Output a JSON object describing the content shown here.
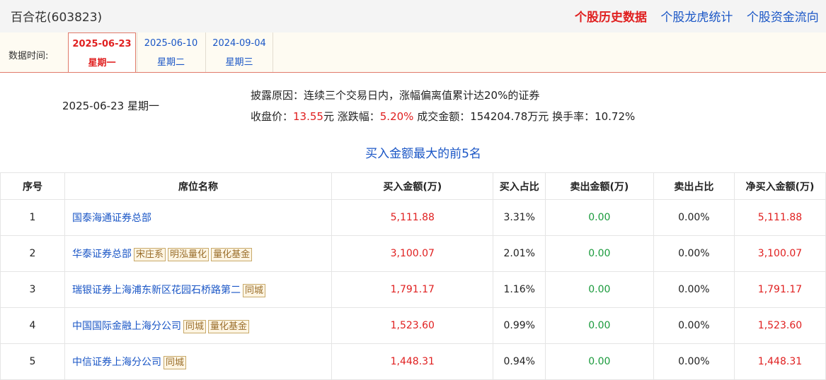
{
  "header": {
    "stock_title": "百合花(603823)",
    "links": [
      {
        "label": "个股历史数据",
        "active": true
      },
      {
        "label": "个股龙虎统计",
        "active": false
      },
      {
        "label": "个股资金流向",
        "active": false
      }
    ]
  },
  "date_bar": {
    "label": "数据时间:",
    "tabs": [
      {
        "date": "2025-06-23",
        "weekday": "星期一",
        "active": true
      },
      {
        "date": "2025-06-10",
        "weekday": "星期二",
        "active": false
      },
      {
        "date": "2024-09-04",
        "weekday": "星期三",
        "active": false
      }
    ]
  },
  "summary": {
    "date": "2025-06-23 星期一",
    "reason": "披露原因：连续三个交易日内，涨幅偏离值累计达20%的证券",
    "close_label": "收盘价：",
    "close_value": "13.55",
    "close_unit": "元 ",
    "change_label": "涨跌幅：",
    "change_value": "5.20%",
    "turnover_text": " 成交金额：154204.78万元 换手率：10.72%"
  },
  "section_title": "买入金额最大的前5名",
  "table": {
    "headers": [
      "序号",
      "席位名称",
      "买入金额(万)",
      "买入占比",
      "卖出金额(万)",
      "卖出占比",
      "净买入金额(万)"
    ],
    "rows": [
      {
        "no": "1",
        "name": "国泰海通证券总部",
        "tags": [],
        "buy": "5,111.88",
        "buy_pct": "3.31%",
        "sell": "0.00",
        "sell_pct": "0.00%",
        "net": "5,111.88"
      },
      {
        "no": "2",
        "name": "华泰证券总部",
        "tags": [
          "宋庄系",
          "明泓量化",
          "量化基金"
        ],
        "buy": "3,100.07",
        "buy_pct": "2.01%",
        "sell": "0.00",
        "sell_pct": "0.00%",
        "net": "3,100.07"
      },
      {
        "no": "3",
        "name": "瑞银证券上海浦东新区花园石桥路第二",
        "tags": [
          "同城"
        ],
        "buy": "1,791.17",
        "buy_pct": "1.16%",
        "sell": "0.00",
        "sell_pct": "0.00%",
        "net": "1,791.17"
      },
      {
        "no": "4",
        "name": "中国国际金融上海分公司",
        "tags": [
          "同城",
          "量化基金"
        ],
        "buy": "1,523.60",
        "buy_pct": "0.99%",
        "sell": "0.00",
        "sell_pct": "0.00%",
        "net": "1,523.60"
      },
      {
        "no": "5",
        "name": "中信证券上海分公司",
        "tags": [
          "同城"
        ],
        "buy": "1,448.31",
        "buy_pct": "0.94%",
        "sell": "0.00",
        "sell_pct": "0.00%",
        "net": "1,448.31"
      }
    ]
  },
  "colors": {
    "red": "#e02020",
    "link": "#1a56c6",
    "green": "#1a9a3c"
  }
}
